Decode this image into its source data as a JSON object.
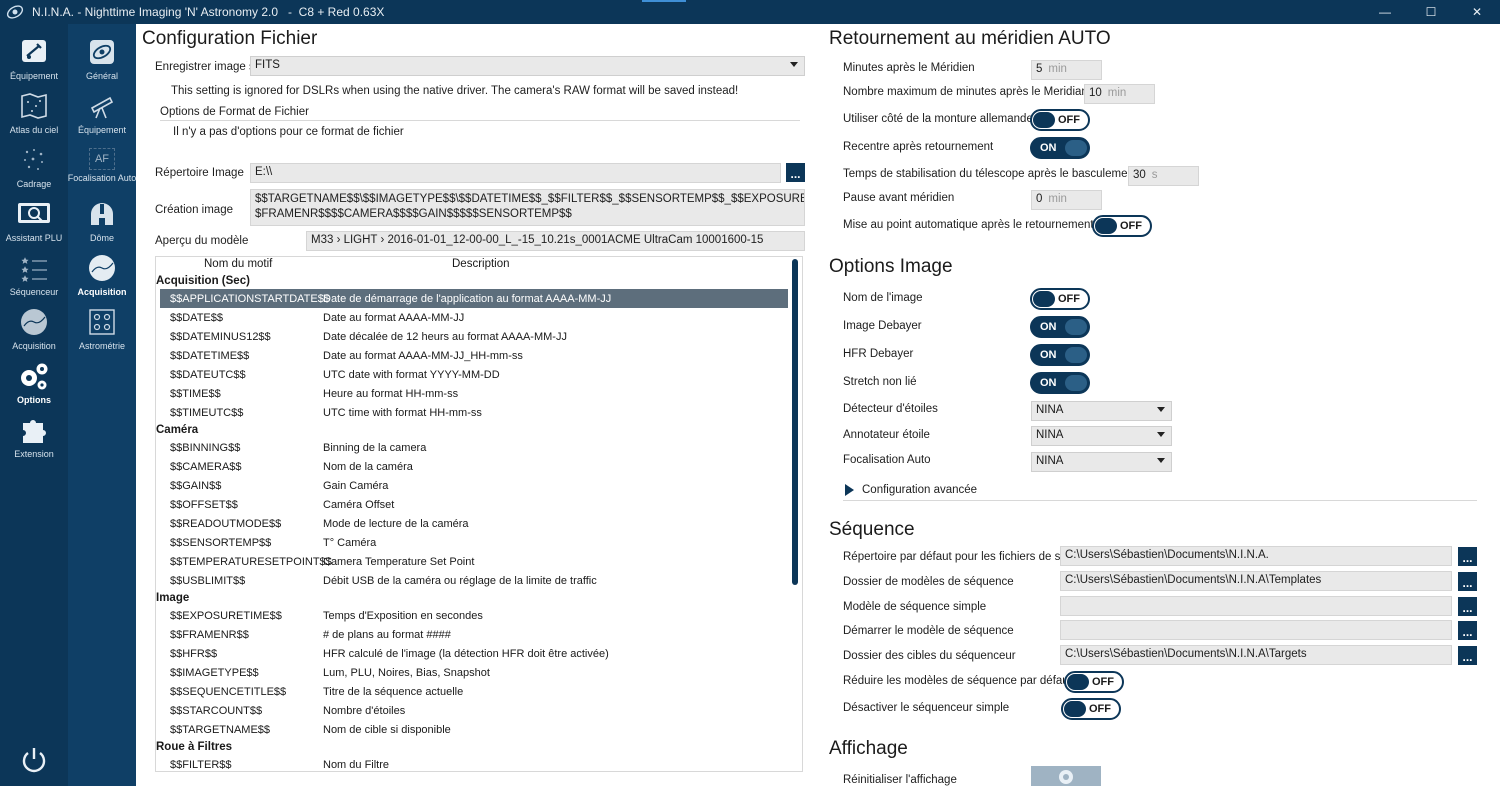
{
  "titlebar": {
    "title": "N.I.N.A. - Nighttime Imaging 'N' Astronomy 2.0   -  C8 + Red 0.63X",
    "minimize": "—",
    "maximize": "☐",
    "close": "✕"
  },
  "nav": {
    "items": [
      {
        "label": "Équipement",
        "icon": "telescope-camera-icon"
      },
      {
        "label": "Atlas du ciel",
        "icon": "sky-atlas-icon"
      },
      {
        "label": "Cadrage",
        "icon": "framing-icon"
      },
      {
        "label": "Assistant PLU",
        "icon": "flat-wizard-icon"
      },
      {
        "label": "Séquenceur",
        "icon": "sequencer-icon"
      },
      {
        "label": "Acquisition",
        "icon": "imaging-icon"
      },
      {
        "label": "Options",
        "icon": "gears-icon"
      },
      {
        "label": "Extension",
        "icon": "puzzle-icon"
      }
    ],
    "active": "Options"
  },
  "subnav": {
    "items": [
      {
        "label": "Général",
        "icon": "general-icon"
      },
      {
        "label": "Équipement",
        "icon": "telescope-icon"
      },
      {
        "label": "Focalisation Auto",
        "icon": "af-icon",
        "glyph": "AF"
      },
      {
        "label": "Dôme",
        "icon": "dome-icon"
      },
      {
        "label": "Acquisition",
        "icon": "acquisition-icon"
      },
      {
        "label": "Astrométrie",
        "icon": "plate-solve-icon"
      }
    ],
    "active": "Acquisition"
  },
  "file_settings": {
    "title": "Configuration Fichier",
    "save_as_label": "Enregistrer image s",
    "save_as_value": "FITS",
    "dslr_note": "This setting is ignored for DSLRs when using the native driver. The camera's RAW format will be saved instead!",
    "format_options_title": "Options de Format de Fichier",
    "format_options_note": "Il n'y a pas d'options pour ce format de fichier",
    "image_dir_label": "Répertoire Image",
    "image_dir_value": "E:\\\\",
    "file_pattern_label": "Création image",
    "file_pattern_line1": "$$TARGETNAME$$\\$$IMAGETYPE$$\\$$DATETIME$$_$$FILTER$$_$$SENSORTEMP$$_$$EXPOSURETIME$$s_$",
    "file_pattern_line2": "$FRAMENR$$$$CAMERA$$$$GAIN$$$$$SENSORTEMP$$",
    "preview_label": "Aperçu du modèle",
    "preview_value": "M33 › LIGHT › 2016-01-01_12-00-00_L_-15_10.21s_0001ACME UltraCam 10001600-15",
    "browse": "..."
  },
  "pattern_table": {
    "col_pattern": "Nom du motif",
    "col_description": "Description",
    "groups": [
      {
        "name": "Acquisition (Sec)",
        "rows": [
          {
            "key": "$$APPLICATIONSTARTDATE$$",
            "desc": "Date de démarrage de l'application au format AAAA-MM-JJ",
            "selected": true
          },
          {
            "key": "$$DATE$$",
            "desc": "Date au format AAAA-MM-JJ"
          },
          {
            "key": "$$DATEMINUS12$$",
            "desc": "Date décalée de 12 heurs au format AAAA-MM-JJ"
          },
          {
            "key": "$$DATETIME$$",
            "desc": "Date au format AAAA-MM-JJ_HH-mm-ss"
          },
          {
            "key": "$$DATEUTC$$",
            "desc": "UTC date with format YYYY-MM-DD"
          },
          {
            "key": "$$TIME$$",
            "desc": "Heure au format HH-mm-ss"
          },
          {
            "key": "$$TIMEUTC$$",
            "desc": "UTC time with format HH-mm-ss"
          }
        ]
      },
      {
        "name": "Caméra",
        "rows": [
          {
            "key": "$$BINNING$$",
            "desc": "Binning de la camera"
          },
          {
            "key": "$$CAMERA$$",
            "desc": "Nom de la caméra"
          },
          {
            "key": "$$GAIN$$",
            "desc": "Gain Caméra"
          },
          {
            "key": "$$OFFSET$$",
            "desc": "Caméra Offset"
          },
          {
            "key": "$$READOUTMODE$$",
            "desc": "Mode de lecture de la caméra"
          },
          {
            "key": "$$SENSORTEMP$$",
            "desc": "T° Caméra"
          },
          {
            "key": "$$TEMPERATURESETPOINT$$",
            "desc": "Camera Temperature Set Point"
          },
          {
            "key": "$$USBLIMIT$$",
            "desc": "Débit USB de la caméra ou réglage de la limite de traffic"
          }
        ]
      },
      {
        "name": "Image",
        "rows": [
          {
            "key": "$$EXPOSURETIME$$",
            "desc": "Temps d'Exposition en secondes"
          },
          {
            "key": "$$FRAMENR$$",
            "desc": "# de plans au format ####"
          },
          {
            "key": "$$HFR$$",
            "desc": "HFR calculé de l'image (la détection HFR doit être activée)"
          },
          {
            "key": "$$IMAGETYPE$$",
            "desc": "Lum, PLU, Noires, Bias, Snapshot"
          },
          {
            "key": "$$SEQUENCETITLE$$",
            "desc": "Titre de la séquence actuelle"
          },
          {
            "key": "$$STARCOUNT$$",
            "desc": "Nombre d'étoiles"
          },
          {
            "key": "$$TARGETNAME$$",
            "desc": "Nom de cible si disponible"
          }
        ]
      },
      {
        "name": "Roue à Filtres",
        "rows": [
          {
            "key": "$$FILTER$$",
            "desc": "Nom du Filtre"
          }
        ]
      }
    ]
  },
  "meridian": {
    "title": "Retournement au méridien AUTO",
    "minutes_after_label": "Minutes après le Méridien",
    "minutes_after_value": "5",
    "minutes_after_unit": "min",
    "max_minutes_label": "Nombre maximum de minutes après le Meridian",
    "max_minutes_value": "10",
    "max_minutes_unit": "min",
    "pier_side_label": "Utiliser côté de la monture allemande",
    "pier_side_state": "OFF",
    "recenter_label": "Recentre après retournement",
    "recenter_state": "ON",
    "settle_label": "Temps de stabilisation du télescope après le basculement",
    "settle_value": "30",
    "settle_unit": "s",
    "pause_label": "Pause avant méridien",
    "pause_value": "0",
    "pause_unit": "min",
    "autofocus_label": "Mise au point automatique après le retournement",
    "autofocus_state": "OFF"
  },
  "image_options": {
    "title": "Options Image",
    "image_name_label": "Nom de l'image",
    "image_name_state": "OFF",
    "debayer_label": "Image Debayer",
    "debayer_state": "ON",
    "hfr_debayer_label": "HFR Debayer",
    "hfr_debayer_state": "ON",
    "unlinked_label": "Stretch non lié",
    "unlinked_state": "ON",
    "star_detector_label": "Détecteur d'étoiles",
    "star_detector_value": "NINA",
    "star_annotator_label": "Annotateur étoile",
    "star_annotator_value": "NINA",
    "autofocus_label": "Focalisation Auto",
    "autofocus_value": "NINA",
    "advanced_label": "Configuration avancée"
  },
  "sequence": {
    "title": "Séquence",
    "default_folder_label": "Répertoire par défaut pour les fichiers de sé",
    "default_folder_value": "C:\\Users\\Sébastien\\Documents\\N.I.N.A.",
    "templates_folder_label": "Dossier de modèles de séquence",
    "templates_folder_value": "C:\\Users\\Sébastien\\Documents\\N.I.N.A\\Templates",
    "simple_template_label": "Modèle de séquence simple",
    "simple_template_value": "",
    "start_template_label": "Démarrer le modèle de séquence",
    "start_template_value": "",
    "targets_folder_label": "Dossier des cibles du séquenceur",
    "targets_folder_value": "C:\\Users\\Sébastien\\Documents\\N.I.N.A\\Targets",
    "collapse_label": "Réduire les modèles de séquence par défaut",
    "collapse_state": "OFF",
    "disable_simple_label": "Désactiver le séquenceur simple",
    "disable_simple_state": "OFF"
  },
  "display": {
    "title": "Affichage",
    "reset_label": "Réinitialiser l'affichage"
  },
  "colors": {
    "nav_bg": "#0c3658",
    "accent": "#0c3658",
    "selected_row": "#5d6e7c"
  }
}
